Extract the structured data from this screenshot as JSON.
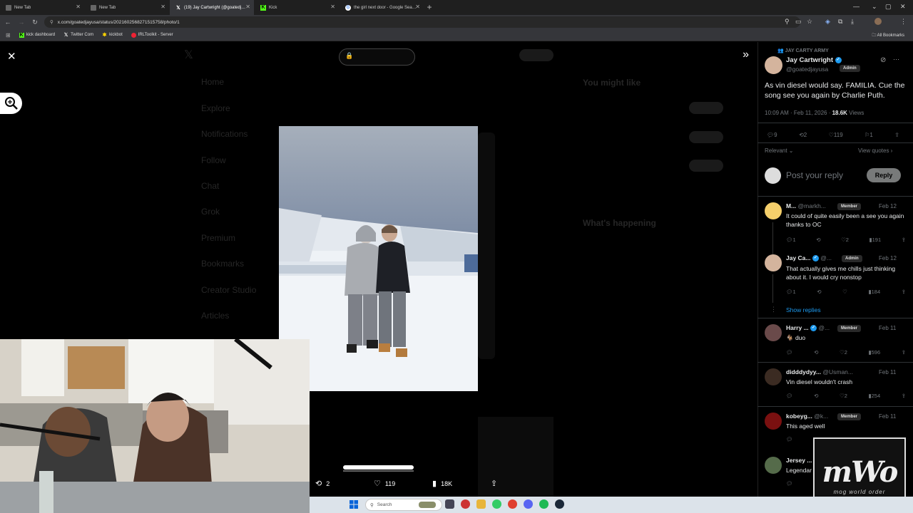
{
  "browser": {
    "tabs": [
      {
        "title": "New Tab",
        "icon": "file-icon",
        "active": false
      },
      {
        "title": "New Tab",
        "icon": "file-icon",
        "active": false
      },
      {
        "title": "(19) Jay Cartwright (@goatedj…",
        "icon": "x-logo-icon",
        "active": true
      },
      {
        "title": "Kick",
        "icon": "kick-logo-icon",
        "active": false
      },
      {
        "title": "the girl next door - Google Sea…",
        "icon": "google-icon",
        "active": false
      }
    ],
    "url": "x.com/goatedjayusa/status/2021602568271515758/photo/1",
    "bookmarks": [
      {
        "label": "kick dashboard",
        "icon": "kick-logo-icon"
      },
      {
        "label": "Twitter Com",
        "icon": "x-logo-icon"
      },
      {
        "label": "kickbot",
        "icon": "bot-icon"
      },
      {
        "label": "IRLToolkit - Server",
        "icon": "irl-icon"
      }
    ],
    "all_bookmarks_label": "All Bookmarks"
  },
  "viewer": {
    "stats": {
      "reposts": "2",
      "likes": "119",
      "views": "18K"
    },
    "ghost_nav": [
      "Home",
      "Explore",
      "Notifications",
      "Follow",
      "Chat",
      "Grok",
      "Premium",
      "Bookmarks",
      "Creator Studio",
      "Articles"
    ],
    "ghost_right": [
      "You might like",
      "What's happening"
    ]
  },
  "panel": {
    "community": "JAY CARTY ARMY",
    "author": {
      "name": "Jay Cartwright",
      "handle": "@goatedjayusa",
      "badge": "Admin"
    },
    "text": "As vin diesel would say. FAMILIA. Cue the song see you again by Charlie Puth.",
    "time": "10:09 AM · Feb 11, 2026 · ",
    "views": "18.6K",
    "views_label": "Views",
    "counts": {
      "replies": "9",
      "reposts": "2",
      "likes": "119",
      "bookmarks": "1"
    },
    "sort_label": "Relevant",
    "quotes_label": "View quotes",
    "reply_placeholder": "Post your reply",
    "reply_button": "Reply",
    "show_replies": "Show replies",
    "replies": [
      {
        "name": "M...",
        "handle": "@markh...",
        "badge": "Member",
        "date": "Feb 12",
        "text": "It could of quite easily been a see you again thanks to OC",
        "counts": [
          "1",
          "",
          "2",
          "191"
        ]
      },
      {
        "name": "Jay Ca...",
        "handle": "@...",
        "badge": "Admin",
        "date": "Feb 12",
        "text": "That actually gives me chills just thinking about it. I would cry nonstop",
        "counts": [
          "1",
          "",
          "",
          "184"
        ]
      },
      {
        "name": "Harry ...",
        "handle": "@...",
        "badge": "Member",
        "date": "Feb 11",
        "text": "🐐 duo",
        "counts": [
          "",
          "",
          "2",
          "596"
        ]
      },
      {
        "name": "didddydyy...",
        "handle": "@Usman...",
        "badge": "",
        "date": "Feb 11",
        "text": "Vin diesel wouldn't crash",
        "counts": [
          "",
          "",
          "2",
          "254"
        ]
      },
      {
        "name": "kobeyg...",
        "handle": "@k...",
        "badge": "Member",
        "date": "Feb 11",
        "text": "This aged well",
        "counts": [
          "",
          "",
          "",
          ""
        ]
      },
      {
        "name": "Jersey ...",
        "handle": "",
        "badge": "",
        "date": "",
        "text": "Legendar",
        "counts": [
          "",
          "",
          "",
          ""
        ]
      }
    ]
  },
  "taskbar": {
    "search_placeholder": "Search"
  },
  "overlay": {
    "logo_text": "mWo",
    "logo_sub": "mog world order"
  },
  "colors": {
    "accent": "#1d9bf0",
    "background": "#000000",
    "panel_text": "#e7e9ea",
    "muted": "#71767b"
  }
}
